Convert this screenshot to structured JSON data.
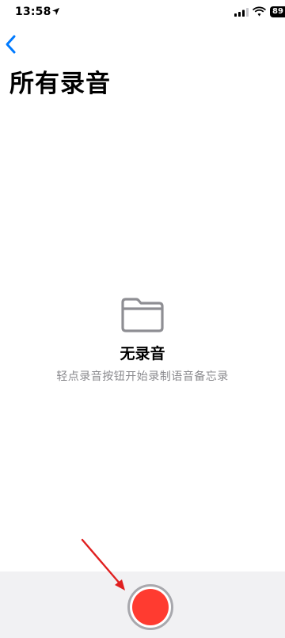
{
  "status_bar": {
    "time": "13:58",
    "battery": "89",
    "icons": [
      "location-arrow-icon",
      "cellular-signal-icon",
      "wifi-icon",
      "battery-icon"
    ]
  },
  "navigation": {
    "back_icon": "chevron-left-icon"
  },
  "page": {
    "title": "所有录音"
  },
  "empty_state": {
    "icon": "folder-icon",
    "title": "无录音",
    "subtitle": "轻点录音按钮开始录制语音备忘录"
  },
  "bottom_bar": {
    "record_button_icon": "record-icon"
  },
  "colors": {
    "accent": "#007aff",
    "record_red": "#ff3b30",
    "secondary_text": "#8a8a8e",
    "bottom_bar_bg": "#f1f1f3",
    "annotation_arrow": "#e02020"
  }
}
